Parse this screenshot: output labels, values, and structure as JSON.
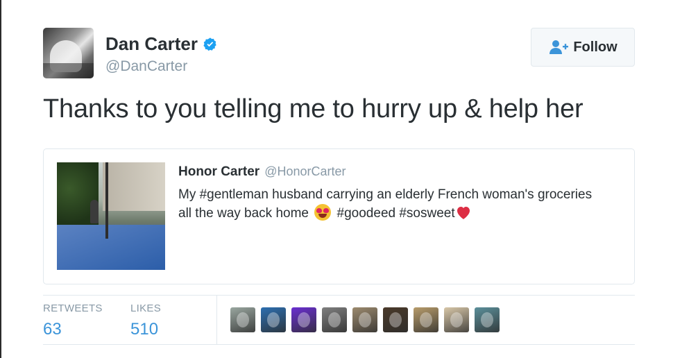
{
  "author": {
    "name": "Dan Carter",
    "handle": "@DanCarter",
    "verified": true,
    "verified_icon": "verified-badge-icon",
    "avatar_icon": "avatar"
  },
  "follow_button": {
    "label": "Follow",
    "icon": "follow-user-icon"
  },
  "tweet": {
    "text": "Thanks to you telling me to hurry up & help her"
  },
  "quoted_tweet": {
    "name": "Honor Carter",
    "handle": "@HonorCarter",
    "text_before_emoji": "My #gentleman husband carrying an elderly French woman's groceries all the way back home ",
    "text_after_emoji": " #goodeed #sosweet",
    "emoji_1": "heart-eyes-emoji",
    "emoji_2": "red-heart-emoji"
  },
  "stats": {
    "retweets_label": "RETWEETS",
    "retweets_value": "63",
    "likes_label": "LIKES",
    "likes_value": "510"
  },
  "likers": [
    {
      "name": "liker-avatar",
      "color": "#9aa7a0"
    },
    {
      "name": "liker-avatar",
      "color": "#2d6fb0"
    },
    {
      "name": "liker-avatar",
      "color": "#6a2fd1"
    },
    {
      "name": "liker-avatar",
      "color": "#7f7f7f"
    },
    {
      "name": "liker-avatar",
      "color": "#9c8a6e"
    },
    {
      "name": "liker-avatar",
      "color": "#4a3a2a"
    },
    {
      "name": "liker-avatar",
      "color": "#b89c6b"
    },
    {
      "name": "liker-avatar",
      "color": "#d8c7a8"
    },
    {
      "name": "liker-avatar",
      "color": "#5b8f9a"
    }
  ],
  "colors": {
    "link": "#3b94d9",
    "muted": "#8899a6",
    "text": "#292f33",
    "border": "#e1e8ed"
  }
}
